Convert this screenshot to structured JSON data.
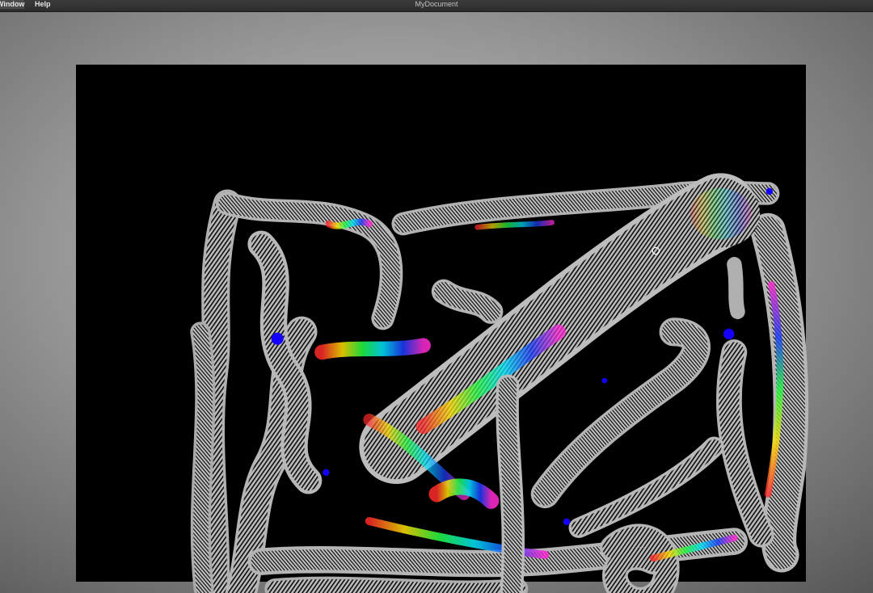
{
  "menubar": {
    "items": [
      {
        "label": "Window"
      },
      {
        "label": "Help"
      }
    ],
    "document_title": "MyDocument"
  },
  "canvas": {
    "background_color": "#000000",
    "tube_base_color": "#b4b4b4",
    "accent_colors": [
      "#ff2a2a",
      "#ffe100",
      "#22ff44",
      "#1a3cff",
      "#ff2ad4",
      "#00e5ff"
    ],
    "marker_color": "#1400ff"
  }
}
